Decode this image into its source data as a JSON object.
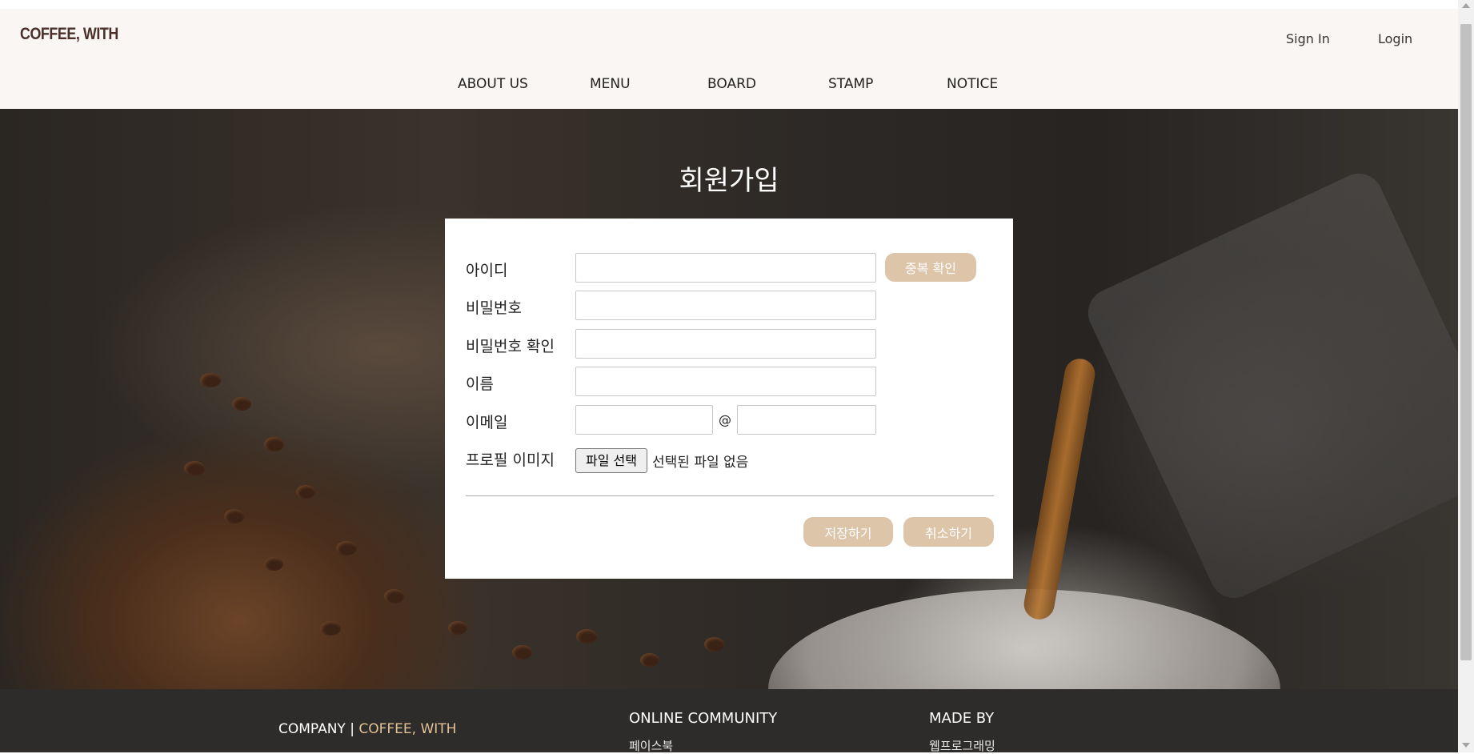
{
  "brand": {
    "logo": "COFFEE, WITH"
  },
  "auth": {
    "sign_in": "Sign In",
    "login": "Login"
  },
  "nav": {
    "items": [
      "ABOUT US",
      "MENU",
      "BOARD",
      "STAMP",
      "NOTICE"
    ]
  },
  "page": {
    "title": "회원가입"
  },
  "form": {
    "labels": {
      "id": "아이디",
      "password": "비밀번호",
      "password_confirm": "비밀번호 확인",
      "name": "이름",
      "email": "이메일",
      "profile_image": "프로필 이미지"
    },
    "values": {
      "id": "",
      "password": "",
      "password_confirm": "",
      "name": "",
      "email_local": "",
      "email_domain": ""
    },
    "at_sign": "@",
    "dup_check_label": "중복 확인",
    "file_button_label": "파일 선택",
    "file_status": "선택된 파일 없음",
    "save_label": "저장하기",
    "cancel_label": "취소하기"
  },
  "footer": {
    "company_prefix": "COMPANY | ",
    "company_name": "COFFEE, WITH",
    "community_heading": "ONLINE COMMUNITY",
    "community_link": "페이스북",
    "made_by_heading": "MADE BY",
    "made_by_value": "웹프로그래밍"
  },
  "colors": {
    "accent_button": "#dcc5a9",
    "header_bg": "#f9f6f3",
    "footer_bg": "#2e2c2a",
    "footer_accent": "#e2c196",
    "logo": "#4a2f2a"
  }
}
